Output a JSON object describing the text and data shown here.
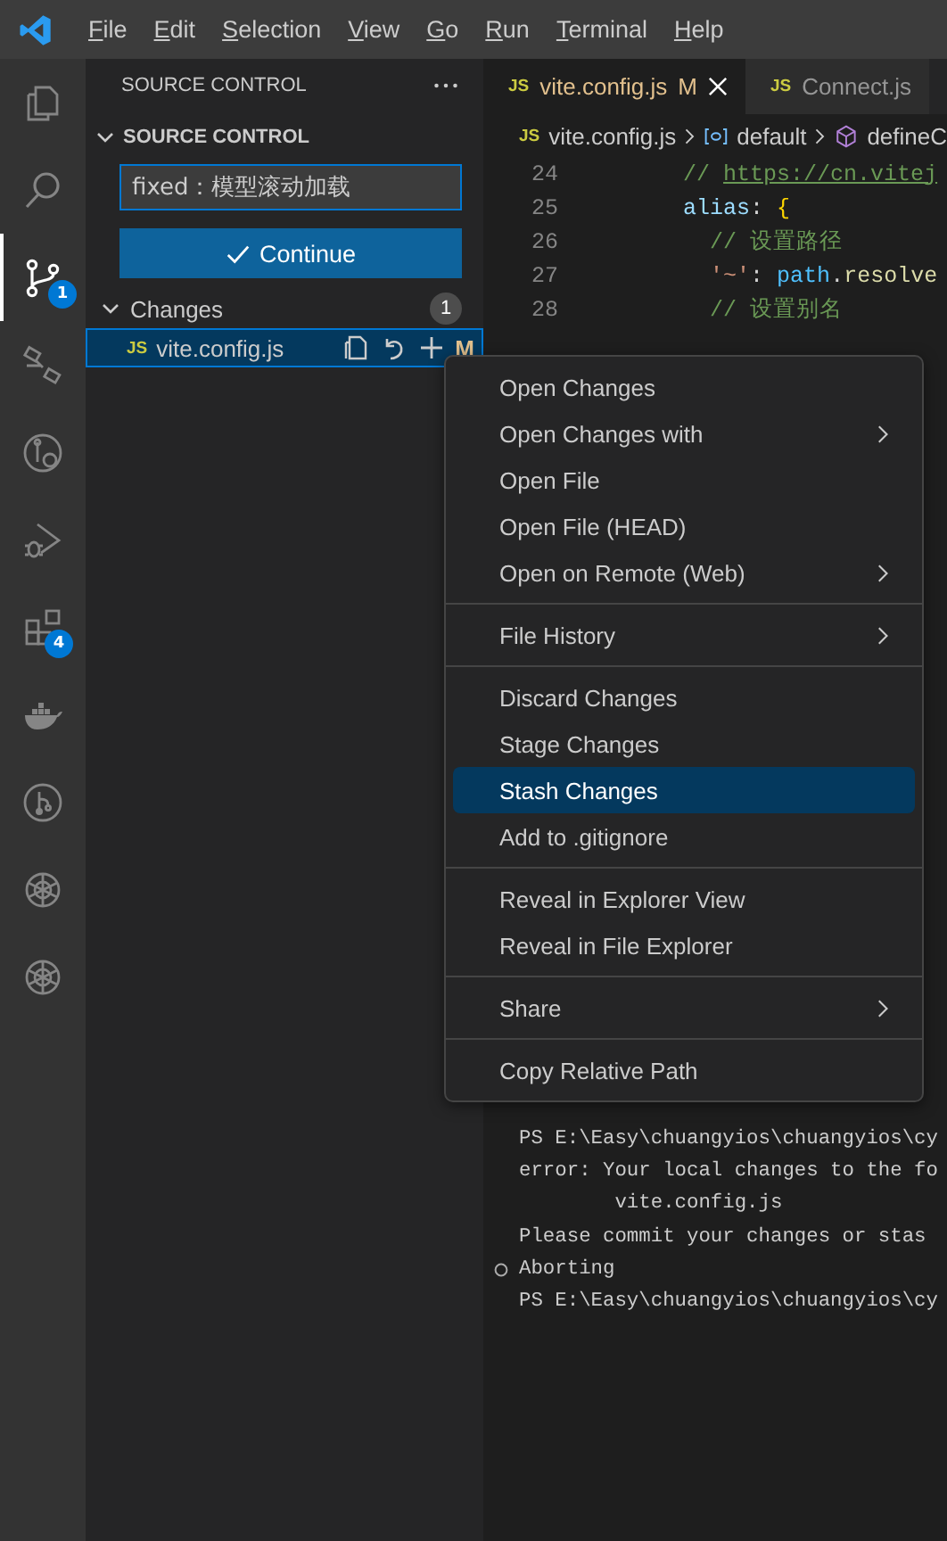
{
  "menubar": {
    "items": [
      "File",
      "Edit",
      "Selection",
      "View",
      "Go",
      "Run",
      "Terminal",
      "Help"
    ]
  },
  "activity_bar": [
    {
      "kind": "files",
      "selected": false
    },
    {
      "kind": "search",
      "selected": false
    },
    {
      "kind": "branch",
      "selected": true,
      "badge": "1"
    },
    {
      "kind": "nodes",
      "selected": false
    },
    {
      "kind": "branch-clock",
      "selected": false
    },
    {
      "kind": "debug",
      "selected": false
    },
    {
      "kind": "extensions",
      "selected": false,
      "badge": "4"
    },
    {
      "kind": "whale",
      "selected": false
    },
    {
      "kind": "graph",
      "selected": false
    },
    {
      "kind": "knot",
      "selected": false
    },
    {
      "kind": "knot",
      "selected": false
    }
  ],
  "sidebar": {
    "title": "SOURCE CONTROL",
    "section": {
      "title": "SOURCE CONTROL",
      "expanded": true
    },
    "commit_message": {
      "value": "fixed：模型滚动加载"
    },
    "commit_button": "Continue",
    "changes": {
      "label": "Changes",
      "expanded": true,
      "count": "1",
      "files": [
        {
          "icon": "JS",
          "name": "vite.config.js",
          "status": "M",
          "selected": true
        }
      ]
    }
  },
  "editor": {
    "tabs": [
      {
        "icon": "JS",
        "label": "vite.config.js",
        "status": "M",
        "selected": true
      },
      {
        "icon": "JS",
        "label": "Connect.js",
        "selected": false
      }
    ],
    "breadcrumb": [
      {
        "kind": "file",
        "icon": "JS",
        "label": "vite.config.js"
      },
      {
        "kind": "variable",
        "label": "default"
      },
      {
        "kind": "method",
        "label": "defineC"
      }
    ],
    "lines": [
      {
        "number": "24",
        "tokens": [
          {
            "kind": "comment",
            "text": "        // "
          },
          {
            "kind": "link",
            "text": "https://cn.vitej"
          }
        ]
      },
      {
        "number": "25",
        "tokens": [
          {
            "kind": "key",
            "text": "        alias"
          },
          {
            "kind": "punct",
            "text": ": "
          },
          {
            "kind": "bracket",
            "text": "{"
          }
        ]
      },
      {
        "number": "26",
        "tokens": [
          {
            "kind": "comment",
            "text": "          // 设置路径"
          }
        ]
      },
      {
        "number": "27",
        "tokens": [
          {
            "kind": "string",
            "text": "          '~'"
          },
          {
            "kind": "punct",
            "text": ": "
          },
          {
            "kind": "var",
            "text": "path"
          },
          {
            "kind": "punct",
            "text": "."
          },
          {
            "kind": "fn",
            "text": "resolve"
          }
        ]
      },
      {
        "number": "28",
        "tokens": [
          {
            "kind": "comment",
            "text": "          // 设置别名"
          }
        ]
      }
    ]
  },
  "context_menu": [
    {
      "kind": "item",
      "label": "Open Changes",
      "submenu": false,
      "selected": false
    },
    {
      "kind": "item",
      "label": "Open Changes with",
      "submenu": true,
      "selected": false
    },
    {
      "kind": "item",
      "label": "Open File",
      "submenu": false,
      "selected": false
    },
    {
      "kind": "item",
      "label": "Open File (HEAD)",
      "submenu": false,
      "selected": false
    },
    {
      "kind": "item",
      "label": "Open on Remote (Web)",
      "submenu": true,
      "selected": false
    },
    {
      "kind": "separator"
    },
    {
      "kind": "item",
      "label": "File History",
      "submenu": true,
      "selected": false
    },
    {
      "kind": "separator"
    },
    {
      "kind": "item",
      "label": "Discard Changes",
      "submenu": false,
      "selected": false
    },
    {
      "kind": "item",
      "label": "Stage Changes",
      "submenu": false,
      "selected": false
    },
    {
      "kind": "item",
      "label": "Stash Changes",
      "submenu": false,
      "selected": true
    },
    {
      "kind": "item",
      "label": "Add to .gitignore",
      "submenu": false,
      "selected": false
    },
    {
      "kind": "separator"
    },
    {
      "kind": "item",
      "label": "Reveal in Explorer View",
      "submenu": false,
      "selected": false
    },
    {
      "kind": "item",
      "label": "Reveal in File Explorer",
      "submenu": false,
      "selected": false
    },
    {
      "kind": "separator"
    },
    {
      "kind": "item",
      "label": "Share",
      "submenu": true,
      "selected": false
    },
    {
      "kind": "separator"
    },
    {
      "kind": "item",
      "label": "Copy Relative Path",
      "submenu": false,
      "selected": false
    }
  ],
  "terminal": {
    "lines": [
      {
        "text": "PS E:\\Easy\\chuangyios\\chuangyios\\cy",
        "marker": false
      },
      {
        "text": "error: Your local changes to the fo",
        "marker": false
      },
      {
        "text": "        vite.config.js",
        "marker": false
      },
      {
        "text": "Please commit your changes or stas",
        "marker": false
      },
      {
        "text": "Aborting",
        "marker": true
      },
      {
        "text": "PS E:\\Easy\\chuangyios\\chuangyios\\cy",
        "marker": false
      }
    ]
  }
}
